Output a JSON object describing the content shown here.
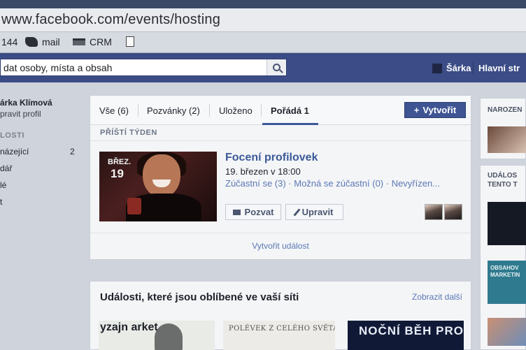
{
  "browser": {
    "url": "www.facebook.com/events/hosting",
    "bookmarks": [
      {
        "label": "144",
        "icon": "none"
      },
      {
        "label": "mail",
        "icon": "mail-icon"
      },
      {
        "label": "CRM",
        "icon": "crm-icon"
      },
      {
        "label": "",
        "icon": "document-icon"
      }
    ]
  },
  "topbar": {
    "search_text": "dat osoby, místa a obsah",
    "user_name": "Šárka",
    "home_label": "Hlavní str"
  },
  "leftnav": {
    "profile_name": "árka Klímová",
    "edit_profile": "pravit profil",
    "section_heading": "LOSTI",
    "items": [
      {
        "label": "názející",
        "count": "2"
      },
      {
        "label": "dář",
        "count": ""
      },
      {
        "label": "lé",
        "count": ""
      },
      {
        "label": "t",
        "count": ""
      }
    ]
  },
  "tabs": [
    {
      "label": "Vše (6)"
    },
    {
      "label": "Pozvánky (2)"
    },
    {
      "label": "Uloženo"
    },
    {
      "label": "Pořádá 1",
      "active": true
    }
  ],
  "create_button": "Vytvořit",
  "section_label": "PŘÍŠTÍ TÝDEN",
  "event": {
    "month": "BŘEZ.",
    "day": "19",
    "title": "Focení profilovek",
    "datetime": "19. březen v 18:00",
    "rsvp": "Zúčastní se (3) · Možná se zúčastní (0) · Nevyřízen...",
    "invite_button": "Pozvat",
    "edit_button": "Upravit"
  },
  "create_event_link": "Vytvořit událost",
  "popular": {
    "title": "Události, které jsou oblíbené ve vaší síti",
    "more_link": "Zobrazit další",
    "thumb1_text": "yzajn arket",
    "thumb2_text": "POLÉVEK Z CELÉHO SVĚTA",
    "thumb3_text": "NOČNÍ BĚH PRO SVĚTLUŠ"
  },
  "rightcol": {
    "box1_heading": "NAROZEN",
    "box2_heading": "UDÁLOS TENTO T",
    "box3_text": "OBSAHOV MARKETIN"
  },
  "colors": {
    "fb_blue": "#3b4c86",
    "link_blue": "#5a78b5",
    "button_blue": "#3e5493"
  }
}
